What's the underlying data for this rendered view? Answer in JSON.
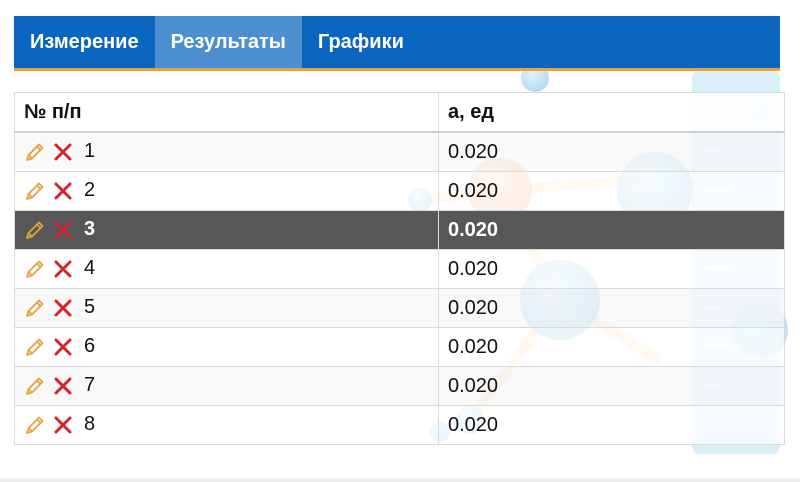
{
  "tabs": [
    {
      "label": "Измерение",
      "active": false
    },
    {
      "label": "Результаты",
      "active": true
    },
    {
      "label": "Графики",
      "active": false
    }
  ],
  "table": {
    "columns": [
      "№ п/п",
      "a, ед"
    ],
    "rows": [
      {
        "n": "1",
        "value": "0.020",
        "selected": false
      },
      {
        "n": "2",
        "value": "0.020",
        "selected": false
      },
      {
        "n": "3",
        "value": "0.020",
        "selected": true
      },
      {
        "n": "4",
        "value": "0.020",
        "selected": false
      },
      {
        "n": "5",
        "value": "0.020",
        "selected": false
      },
      {
        "n": "6",
        "value": "0.020",
        "selected": false
      },
      {
        "n": "7",
        "value": "0.020",
        "selected": false
      },
      {
        "n": "8",
        "value": "0.020",
        "selected": false
      }
    ],
    "row_actions": [
      {
        "icon": "pencil-icon",
        "color": "#e8a23a"
      },
      {
        "icon": "close-icon",
        "color": "#d8232a"
      }
    ]
  },
  "colors": {
    "tabbar": "#0b66c2",
    "tab_active": "#4d90d2",
    "tab_underline": "#e8a23a",
    "selected_row": "#575757"
  }
}
